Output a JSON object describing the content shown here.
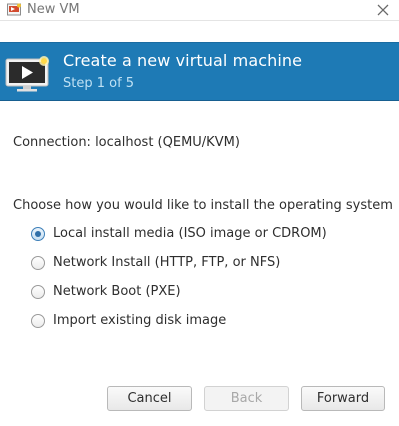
{
  "window": {
    "title": "New VM",
    "app_icon": "virt-manager-icon",
    "close_icon": "close-icon"
  },
  "header": {
    "title": "Create a new virtual machine",
    "step": "Step 1 of 5",
    "icon": "virtual-machine-icon",
    "background_color": "#1e7ab5"
  },
  "connection": {
    "text": "Connection: localhost (QEMU/KVM)"
  },
  "install": {
    "prompt": "Choose how you would like to install the operating system",
    "selected": 0,
    "options": [
      {
        "label": "Local install media (ISO image or CDROM)",
        "checked": true
      },
      {
        "label": "Network Install (HTTP, FTP, or NFS)",
        "checked": false
      },
      {
        "label": "Network Boot (PXE)",
        "checked": false
      },
      {
        "label": "Import existing disk image",
        "checked": false
      }
    ]
  },
  "buttons": {
    "cancel": {
      "label": "Cancel",
      "enabled": true
    },
    "back": {
      "label": "Back",
      "enabled": false
    },
    "forward": {
      "label": "Forward",
      "enabled": true
    }
  }
}
